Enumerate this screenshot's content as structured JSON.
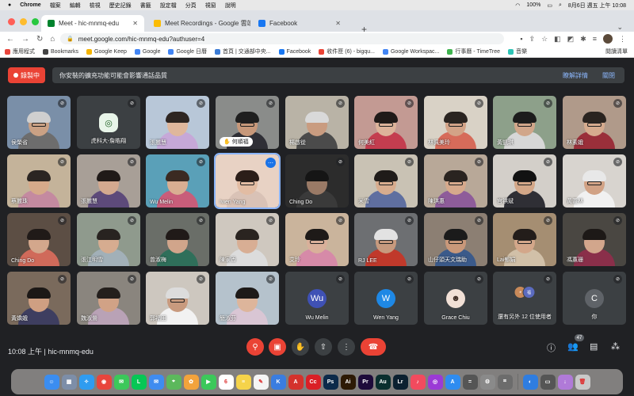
{
  "menubar": {
    "app": "Chrome",
    "items": [
      "檔案",
      "編輯",
      "檢視",
      "歷史記錄",
      "書籤",
      "設定檔",
      "分頁",
      "視窗",
      "說明"
    ],
    "battery": "100%",
    "clock": "8月6日 週五 上午 10:08"
  },
  "tabs": [
    {
      "title": "Meet - hic-mnmq-edu",
      "fav": "#00832d",
      "active": true
    },
    {
      "title": "Meet Recordings - Google 雲端",
      "fav": "#fbbc04",
      "active": false
    },
    {
      "title": "Facebook",
      "fav": "#1877f2",
      "active": false
    }
  ],
  "omnibox": {
    "url": "meet.google.com/hic-mnmq-edu?authuser=4"
  },
  "bookmarks": [
    "應用程式",
    "Bookmarks",
    "Google Keep",
    "Google",
    "Google 日曆",
    "首頁 | 交通部中央...",
    "Facebook",
    "收件匣 (6) - bigqu...",
    "Google Workspac...",
    "行事曆 - TimeTree",
    "音樂"
  ],
  "bookmarks_right": "閱讀清單",
  "recording": {
    "label": "錄製中"
  },
  "banner": {
    "text": "你安裝的擴充功能可能會影響通話品質",
    "details": "瞭解詳情",
    "close": "關閉"
  },
  "tiles": [
    {
      "name": "侯榮省",
      "bg": "#7a8fa8",
      "sk": "#caa184",
      "hair": "#cfcfcf",
      "shirt": "#6d6d6d",
      "glasses": true
    },
    {
      "name": "虎科大-詹皓翔",
      "letter": "",
      "bg": "#3c4043",
      "logo": true
    },
    {
      "name": "張麗慧",
      "bg": "#b8c7d8",
      "sk": "#dfb79c",
      "hair": "#2e2622",
      "shirt": "#c6a8d8",
      "glasses": false
    },
    {
      "name": "何順福",
      "bg": "#8a8c8a",
      "sk": "#c7987a",
      "hair": "#1f1f1f",
      "shirt": "#2f2f36",
      "glasses": true,
      "hand": true
    },
    {
      "name": "楊啟從",
      "bg": "#b9b3a6",
      "sk": "#c99c80",
      "hair": "#d9d9d9",
      "shirt": "#4b4b4b",
      "glasses": false
    },
    {
      "name": "何美紅",
      "bg": "#c39a93",
      "sk": "#ddb39a",
      "hair": "#201a18",
      "shirt": "#c43d4f",
      "glasses": true
    },
    {
      "name": "林佩美玲",
      "bg": "#d9d2c6",
      "sk": "#d3a387",
      "hair": "#2a2420",
      "shirt": "#d66b5a",
      "glasses": true
    },
    {
      "name": "黃凱琪",
      "bg": "#8da08a",
      "sk": "#d1a68a",
      "hair": "#1c1c1c",
      "shirt": "#d7d7d7",
      "glasses": true
    },
    {
      "name": "林素娥",
      "bg": "#b09a8a",
      "sk": "#d6ab8e",
      "hair": "#2a2420",
      "shirt": "#9a2f3a",
      "glasses": true
    },
    {
      "name": "蔡麗珠",
      "bg": "#c4b39a",
      "sk": "#d6aa8a",
      "hair": "#2b2522",
      "shirt": "#c48aa0",
      "glasses": false
    },
    {
      "name": "張麗慧",
      "bg": "#a89f97",
      "sk": "#d3a98f",
      "hair": "#201a18",
      "shirt": "#5d4a7a",
      "glasses": false
    },
    {
      "name": "Wu Melin",
      "bg": "#5aa0b8",
      "sk": "#d9ae92",
      "hair": "#3b2a22",
      "shirt": "#c85d7a",
      "glasses": false
    },
    {
      "name": "Iwen Yang",
      "bg": "#e8d2c4",
      "sk": "#e2bca3",
      "hair": "#2b1e19",
      "shirt": "#d9c2b6",
      "glasses": true,
      "sel": true
    },
    {
      "name": "Ching Do",
      "bg": "#2c2c2c",
      "sk": "#9a7a66",
      "hair": "#151515",
      "shirt": "#3a3a3a",
      "glasses": false
    },
    {
      "name": "米雪",
      "bg": "#c9c2b4",
      "sk": "#d7ac8e",
      "hair": "#1f1b19",
      "shirt": "#5f6fa0",
      "glasses": true
    },
    {
      "name": "陳琪惠",
      "bg": "#b8a898",
      "sk": "#d6a98c",
      "hair": "#2a2420",
      "shirt": "#8e5c9a",
      "glasses": true
    },
    {
      "name": "官祺斌",
      "bg": "#d3cfc9",
      "sk": "#d3a788",
      "hair": "#121212",
      "shirt": "#2f2f35",
      "glasses": true
    },
    {
      "name": "黃義林",
      "bg": "#d8d4cf",
      "sk": "#d1a285",
      "hair": "#e8e8e8",
      "shirt": "#f1f1f1",
      "glasses": true
    },
    {
      "name": "Ching Do",
      "bg": "#5c4e44",
      "sk": "#d3a78c",
      "hair": "#201a18",
      "shirt": "#d06a5a",
      "glasses": false
    },
    {
      "name": "張江明雪",
      "bg": "#8f9a8d",
      "sk": "#d6ac90",
      "hair": "#282320",
      "shirt": "#a2b0b8",
      "glasses": false
    },
    {
      "name": "曾淑梅",
      "bg": "#6a6e68",
      "sk": "#d1a58b",
      "hair": "#201a18",
      "shirt": "#2f6f5a",
      "glasses": false
    },
    {
      "name": "陳家香",
      "bg": "#cfc8bf",
      "sk": "#d8ae94",
      "hair": "#2a2420",
      "shirt": "#dcdcdc",
      "glasses": false
    },
    {
      "name": "艾玲",
      "bg": "#cab49c",
      "sk": "#d9b09a",
      "hair": "#1e1a18",
      "shirt": "#d68aa8",
      "glasses": true
    },
    {
      "name": "RJ LEE",
      "bg": "#6d6f72",
      "sk": "#c79a7e",
      "hair": "#e2e2e2",
      "shirt": "#c0392b",
      "glasses": true
    },
    {
      "name": "山仔頭天文瑞助",
      "bg": "#8c7f73",
      "sk": "#c9987a",
      "hair": "#1b1b1b",
      "shirt": "#3b5a8a",
      "glasses": true
    },
    {
      "name": "Lai郁娟",
      "bg": "#a58e72",
      "sk": "#d3a78a",
      "hair": "#231d1a",
      "shirt": "#d1c0a8",
      "glasses": true
    },
    {
      "name": "馮蕙珊",
      "bg": "#4a4742",
      "sk": "#d2a68c",
      "hair": "#1d1917",
      "shirt": "#8a2f4a",
      "glasses": false
    },
    {
      "name": "黃嬌娥",
      "bg": "#7a6a5c",
      "sk": "#cf9f82",
      "hair": "#1c1816",
      "shirt": "#3e3e60",
      "glasses": false
    },
    {
      "name": "魏淑鶯",
      "bg": "#8a857e",
      "sk": "#d1a286",
      "hair": "#241f1c",
      "shirt": "#b9a2b6",
      "glasses": false
    },
    {
      "name": "郭福田",
      "bg": "#cdc7bf",
      "sk": "#c89a7e",
      "hair": "#dcdcdc",
      "shirt": "#f2f2f2",
      "glasses": true
    },
    {
      "name": "簡淑芬",
      "bg": "#b5c2cc",
      "sk": "#ddb59b",
      "hair": "#1e1a18",
      "shirt": "#d9c6d4",
      "glasses": false
    },
    {
      "name": "Wu Melin",
      "letter": "Wu",
      "lbg": "#3f51b5"
    },
    {
      "name": "Wen Yang",
      "letter": "W",
      "lbg": "#1e88e5"
    },
    {
      "name": "Grace Chiu",
      "avatar": true
    },
    {
      "name": "還有另外 12 位使用者",
      "others": true
    },
    {
      "name": "你",
      "letter": "C",
      "lbg": "#5f6368"
    }
  ],
  "bottom": {
    "meeting_code": "10:08 上午 | hic-mnmq-edu",
    "people_count": "47"
  },
  "dock": [
    {
      "n": "finder",
      "c": "#3b8df0",
      "t": "☺"
    },
    {
      "n": "launchpad",
      "c": "#7d8ea8",
      "t": "▦"
    },
    {
      "n": "safari",
      "c": "#2f9cf0",
      "t": "✧"
    },
    {
      "n": "chrome",
      "c": "#e8453c",
      "t": "◉"
    },
    {
      "n": "messages",
      "c": "#3cc85a",
      "t": "✉"
    },
    {
      "n": "line",
      "c": "#06c755",
      "t": "L"
    },
    {
      "n": "mail",
      "c": "#3f8cf0",
      "t": "✉"
    },
    {
      "n": "maps",
      "c": "#5cb85c",
      "t": "⌖"
    },
    {
      "n": "photos",
      "c": "#f2a33c",
      "t": "✿"
    },
    {
      "n": "facetime",
      "c": "#3cc85a",
      "t": "▶"
    },
    {
      "n": "calendar",
      "c": "#ffffff",
      "t": "6"
    },
    {
      "n": "notes",
      "c": "#f5d34a",
      "t": "≡"
    },
    {
      "n": "freeform",
      "c": "#f4f4f4",
      "t": "✎"
    },
    {
      "n": "keynote",
      "c": "#3a7de0",
      "t": "K"
    },
    {
      "n": "acrobat",
      "c": "#d4322c",
      "t": "A"
    },
    {
      "n": "creative-cloud",
      "c": "#da1f26",
      "t": "Cc"
    },
    {
      "n": "photoshop",
      "c": "#0c2a4a",
      "t": "Ps"
    },
    {
      "n": "illustrator",
      "c": "#2d1a05",
      "t": "Ai"
    },
    {
      "n": "premiere",
      "c": "#1d0b3a",
      "t": "Pr"
    },
    {
      "n": "audition",
      "c": "#0a2f2f",
      "t": "Au"
    },
    {
      "n": "lightroom",
      "c": "#0b2030",
      "t": "Lr"
    },
    {
      "n": "music",
      "c": "#f24b5e",
      "t": "♪"
    },
    {
      "n": "podcasts",
      "c": "#9b3ad6",
      "t": "◎"
    },
    {
      "n": "appstore",
      "c": "#2f8cf0",
      "t": "A"
    },
    {
      "n": "calculator",
      "c": "#555555",
      "t": "="
    },
    {
      "n": "system-preferences",
      "c": "#8a8a8a",
      "t": "⚙"
    },
    {
      "n": "screenshot",
      "c": "#6c6c6c",
      "t": "⌗"
    },
    {
      "n": "sep",
      "c": "",
      "t": ""
    },
    {
      "n": "preview",
      "c": "#2f7de0",
      "t": "◐"
    },
    {
      "n": "facetime2",
      "c": "#555555",
      "t": "▭"
    },
    {
      "n": "downloads",
      "c": "#b07ad8",
      "t": "↓"
    },
    {
      "n": "trash",
      "c": "#c9c9c9",
      "t": "🗑"
    }
  ]
}
